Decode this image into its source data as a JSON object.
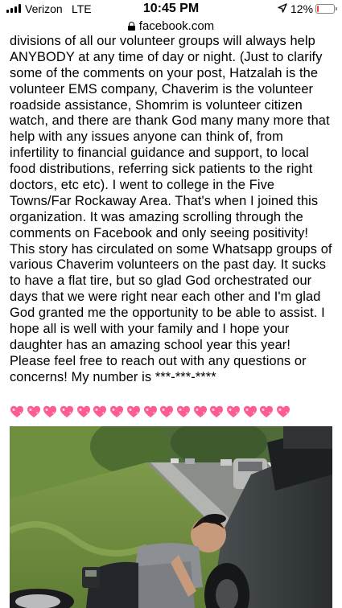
{
  "status_bar": {
    "carrier": "Verizon",
    "network": "LTE",
    "time": "10:45 PM",
    "battery_percent": "12%",
    "battery_level": 0.12,
    "location_icon": "location-arrow-icon",
    "signal_icon": "cellular-signal-icon"
  },
  "url_bar": {
    "domain": "facebook.com",
    "lock_icon": "lock-icon"
  },
  "post": {
    "lines": [
      "divisions of all our volunteer groups will always help",
      "ANYBODY at any time of day or night. (Just to clarify",
      "some of the comments on your post, Hatzalah is the",
      "volunteer EMS company, Chaverim is the volunteer",
      "roadside assistance, Shomrim is volunteer citizen",
      "watch, and there are thank God many many more that",
      "help with any issues anyone can think of, from",
      "infertility to financial guidance and support, to local",
      "food distributions, referring sick patients to the right",
      "doctors, etc etc). I went to college in the Five",
      "Towns/Far Rockaway Area. That's when I joined this",
      "organization. It was amazing scrolling through the",
      "comments on Facebook and only seeing positivity!",
      "This story has circulated on some Whatsapp groups of",
      "various Chaverim volunteers on the past day. It sucks",
      "to have a flat tire, but so glad God orchestrated our",
      "days that we were right near each other and I'm glad",
      "God granted me the opportunity to be able to assist. I",
      "hope all is well with your family and I hope your",
      "daughter has an amazing school year this year!",
      "Please feel free to reach out with any questions or",
      "concerns! My number is ***-***-****"
    ],
    "emoji_icon": "sparkling-heart-icon",
    "emoji_count": 17,
    "photo_icon": "post-photo-man-changing-tire"
  },
  "colors": {
    "heart_pink": "#ff5c93",
    "battery_red": "#ff3b30"
  }
}
